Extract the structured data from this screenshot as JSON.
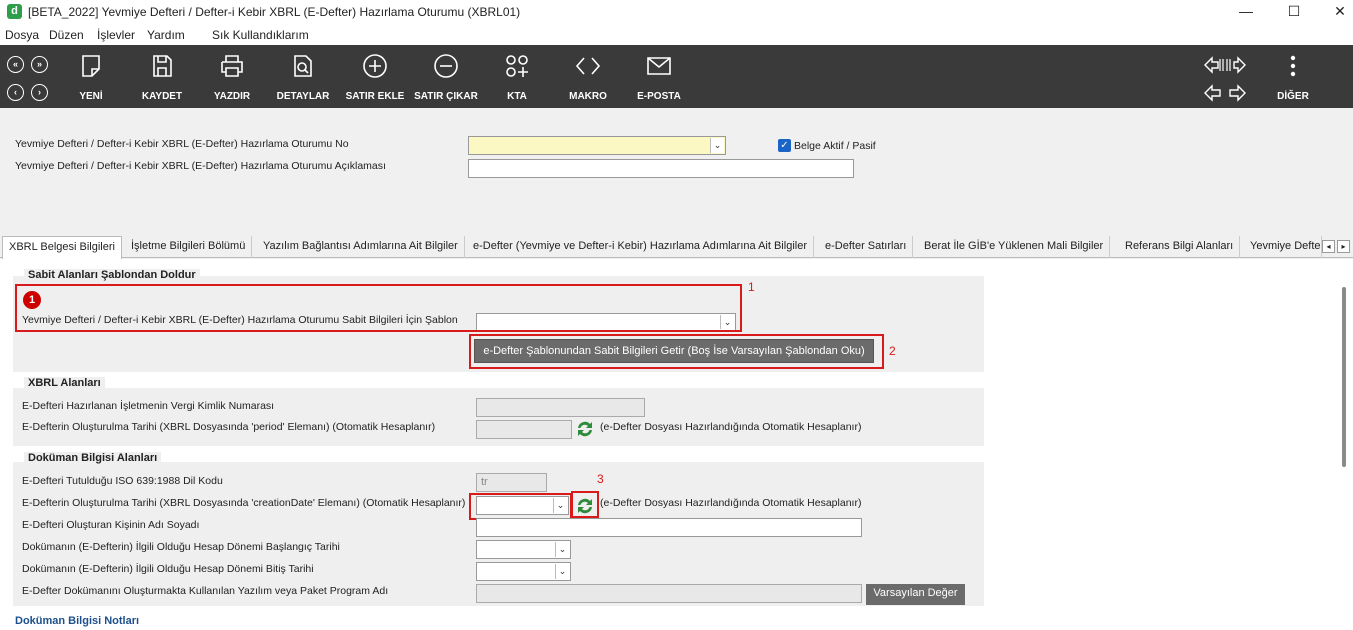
{
  "window": {
    "title": "[BETA_2022] Yevmiye Defteri / Defter-i Kebir XBRL (E-Defter) Hazırlama Oturumu (XBRL01)",
    "app_icon": "d",
    "minimize_icon": "—",
    "maximize_icon": "☐",
    "close_icon": "✕"
  },
  "menu": [
    "Dosya",
    "Düzen",
    "İşlevler",
    "Yardım",
    "Sık Kullandıklarım"
  ],
  "toolbar": {
    "nav": [
      "«",
      "»",
      "‹",
      "›"
    ],
    "buttons": [
      {
        "label": "YENİ",
        "icon": "new-icon"
      },
      {
        "label": "KAYDET",
        "icon": "save-icon"
      },
      {
        "label": "YAZDIR",
        "icon": "print-icon"
      },
      {
        "label": "DETAYLAR",
        "icon": "details-icon"
      },
      {
        "label": "SATIR EKLE",
        "icon": "plus-icon"
      },
      {
        "label": "SATIR ÇIKAR",
        "icon": "minus-icon"
      },
      {
        "label": "KTA",
        "icon": "kta-icon"
      },
      {
        "label": "MAKRO",
        "icon": "code-icon"
      },
      {
        "label": "E-POSTA",
        "icon": "mail-icon"
      }
    ],
    "more_label": "DİĞER"
  },
  "header": {
    "session_no_label": "Yevmiye Defteri / Defter-i Kebir XBRL (E-Defter) Hazırlama Oturumu No",
    "session_desc_label": "Yevmiye Defteri / Defter-i Kebir XBRL (E-Defter) Hazırlama Oturumu Açıklaması",
    "session_no_value": "",
    "session_desc_value": "",
    "active_label": "Belge Aktif / Pasif",
    "active_checked": true
  },
  "tabs": [
    "XBRL Belgesi Bilgileri",
    "İşletme Bilgileri Bölümü",
    "Yazılım Bağlantısı Adımlarına Ait Bilgiler",
    "e-Defter (Yevmiye ve Defter-i Kebir) Hazırlama Adımlarına Ait Bilgiler",
    "e-Defter Satırları",
    "Berat İle GİB'e Yüklenen Mali Bilgiler",
    "Referans Bilgi Alanları",
    "Yevmiye Defte"
  ],
  "template_section": {
    "title": "Sabit Alanları Şablondan Doldur",
    "template_label": "Yevmiye Defteri / Defter-i Kebir XBRL (E-Defter) Hazırlama Oturumu Sabit Bilgileri İçin Şablon",
    "template_value": "",
    "fetch_button": "e-Defter Şablonundan Sabit Bilgileri Getir (Boş İse Varsayılan Şablondan Oku)"
  },
  "xbrl_section": {
    "title": "XBRL Alanları",
    "vkn_label": "E-Defteri Hazırlanan İşletmenin Vergi Kimlik Numarası",
    "vkn_value": "",
    "period_label": "E-Defterin Oluşturulma Tarihi (XBRL Dosyasında 'period' Elemanı) (Otomatik Hesaplanır)",
    "period_value": "",
    "period_note": "(e-Defter Dosyası Hazırlandığında Otomatik Hesaplanır)"
  },
  "doc_section": {
    "title": "Doküman Bilgisi Alanları",
    "lang_label": "E-Defteri Tutulduğu ISO 639:1988 Dil Kodu",
    "lang_value": "tr",
    "creation_label": "E-Defterin Oluşturulma Tarihi (XBRL Dosyasında 'creationDate' Elemanı) (Otomatik Hesaplanır)",
    "creation_value": "",
    "creation_note": "(e-Defter Dosyası Hazırlandığında Otomatik Hesaplanır)",
    "creator_label": "E-Defteri Oluşturan Kişinin Adı Soyadı",
    "creator_value": "",
    "start_label": "Dokümanın (E-Defterin) İlgili Olduğu Hesap Dönemi Başlangıç Tarihi",
    "start_value": "",
    "end_label": "Dokümanın (E-Defterin) İlgili Olduğu Hesap Dönemi Bitiş Tarihi",
    "end_value": "",
    "software_label": "E-Defter Dokümanını Oluşturmakta Kullanılan Yazılım veya Paket Program Adı",
    "software_value": "",
    "default_button": "Varsayılan Değer"
  },
  "notes_title": "Doküman Bilgisi Notları",
  "annotations": {
    "n1": "1",
    "n2": "2",
    "n3": "3",
    "circle": "1"
  },
  "colors": {
    "toolbar": "#3a3a3a",
    "highlight": "#d91a1a",
    "required_field": "#fbf8c3",
    "refresh": "#2e8b3c"
  }
}
